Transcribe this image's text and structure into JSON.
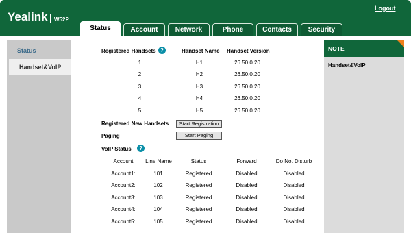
{
  "header": {
    "logo": "Yealink",
    "model": "W52P",
    "logout": "Logout",
    "tabs": [
      "Status",
      "Account",
      "Network",
      "Phone",
      "Contacts",
      "Security"
    ],
    "active_tab": "Status"
  },
  "sidebar": {
    "items": [
      {
        "label": "Status"
      },
      {
        "label": "Handset&VoIP"
      }
    ],
    "active": "Handset&VoIP"
  },
  "handsets": {
    "title": "Registered Handsets",
    "headers": {
      "name": "Handset Name",
      "version": "Handset Version"
    },
    "rows": [
      {
        "num": "1",
        "name": "H1",
        "version": "26.50.0.20"
      },
      {
        "num": "2",
        "name": "H2",
        "version": "26.50.0.20"
      },
      {
        "num": "3",
        "name": "H3",
        "version": "26.50.0.20"
      },
      {
        "num": "4",
        "name": "H4",
        "version": "26.50.0.20"
      },
      {
        "num": "5",
        "name": "H5",
        "version": "26.50.0.20"
      }
    ],
    "register_label": "Registered New Handsets",
    "register_button": "Start Registration",
    "paging_label": "Paging",
    "paging_button": "Start Paging"
  },
  "voip": {
    "title": "VoIP Status",
    "headers": [
      "Account",
      "Line Name",
      "Status",
      "Forward",
      "Do Not Disturb"
    ],
    "rows": [
      [
        "Account1:",
        "101",
        "Registered",
        "Disabled",
        "Disabled"
      ],
      [
        "Account2:",
        "102",
        "Registered",
        "Disabled",
        "Disabled"
      ],
      [
        "Account3:",
        "103",
        "Registered",
        "Disabled",
        "Disabled"
      ],
      [
        "Account4:",
        "104",
        "Registered",
        "Disabled",
        "Disabled"
      ],
      [
        "Account5:",
        "105",
        "Registered",
        "Disabled",
        "Disabled"
      ]
    ]
  },
  "note": {
    "title": "NOTE",
    "text": "Handset&VoIP"
  },
  "colors": {
    "brand_green": "#10663a",
    "note_corner": "#ef7f1a",
    "help_icon": "#0b8fa8"
  }
}
